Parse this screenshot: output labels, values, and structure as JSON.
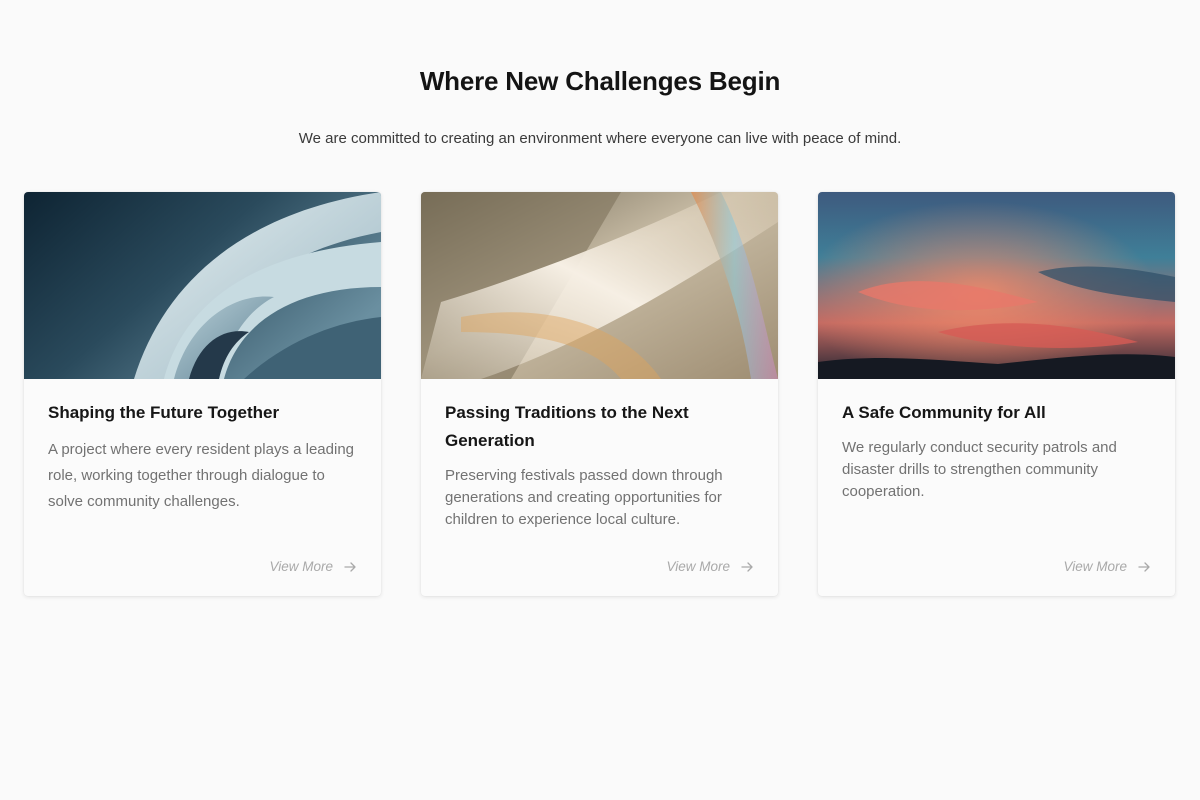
{
  "section": {
    "title": "Where New Challenges Begin",
    "subtitle": "We are committed to creating an environment where everyone can live with peace of mind."
  },
  "cards": [
    {
      "title": "Shaping the Future Together",
      "text": "A project where every resident plays a leading role, working together through dialogue to solve community challenges.",
      "link_label": "View More",
      "image": "abstract-architecture-photo"
    },
    {
      "title": "Passing Traditions to the Next Generation",
      "text": "Preserving festivals passed down through generations and creating opportunities for children to experience local culture.",
      "link_label": "View More",
      "image": "prismatic-light-photo"
    },
    {
      "title": "A Safe Community for All",
      "text": "We regularly conduct security patrols and disaster drills to strengthen community cooperation.",
      "link_label": "View More",
      "image": "sunset-sky-photo"
    }
  ],
  "icons": {
    "link_arrow": "arrow-right-icon"
  },
  "colors": {
    "background": "#fafafa",
    "heading": "#141414",
    "body_text": "#727272",
    "link": "#a9a9a9"
  }
}
